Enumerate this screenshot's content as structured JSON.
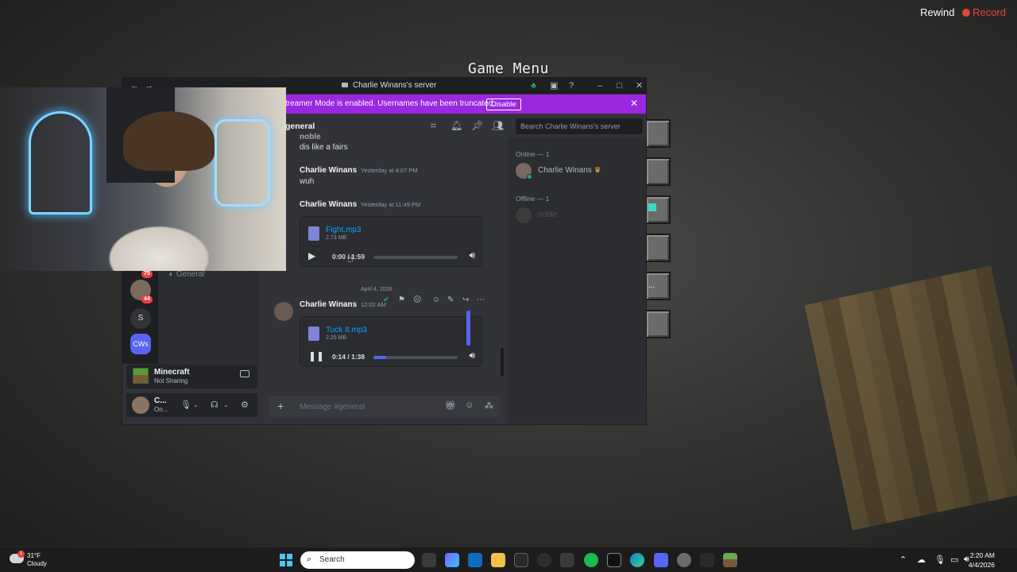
{
  "overlay": {
    "rewind_label": "Rewind",
    "record_label": "Record"
  },
  "game": {
    "menu_title": "Game Menu"
  },
  "window": {
    "title": "Charlie Winans's server",
    "back_icon": "arrow-left-icon",
    "forward_icon": "arrow-right-icon"
  },
  "banner": {
    "text": "treamer Mode is enabled. Usernames have been truncated.",
    "disable_label": "Disable",
    "color": "#9b27e0"
  },
  "guilds": {
    "badge_1": "75",
    "badge_2": "44",
    "s_label": "S",
    "cws_label": "CWs"
  },
  "channels": {
    "voice_channel": "General"
  },
  "activity": {
    "game": "Minecraft",
    "status": "Not Sharing"
  },
  "user": {
    "name": "C...",
    "status": "On..."
  },
  "channel_header": {
    "name": "general",
    "search_placeholder": "Search Charlie Winans's server"
  },
  "messages": {
    "m0_author": "noble",
    "m0_text": "dis like a fairs",
    "m1_author": "Charlie Winans",
    "m1_time": "Yesterday at 4:07 PM",
    "m1_text": "wuh",
    "m2_author": "Charlie Winans",
    "m2_time": "Yesterday at 11:49 PM",
    "m2_file": "Fight.mp3",
    "m2_size": "2.73 MB",
    "m2_progress": "0:00 / 1:59",
    "date_divider": "April 4, 2026",
    "m3_author": "Charlie Winans",
    "m3_time": "12:02 AM",
    "m3_file": "Tuck It.mp3",
    "m3_size": "2.25 MB",
    "m3_progress": "0:14 / 1:38"
  },
  "audio_progress": {
    "m2_fraction": 0.0,
    "m3_fraction": 0.15
  },
  "composer": {
    "placeholder": "Message #general"
  },
  "members": {
    "online_header": "Online — 1",
    "online_member": "Charlie Winans",
    "offline_header": "Offline — 1",
    "offline_member": "noble"
  },
  "taskbar": {
    "temp": "31°F",
    "weather": "Cloudy",
    "weather_badge": "1",
    "search_label": "Search",
    "time": "2:20 AM",
    "date": "4/4/2026"
  }
}
